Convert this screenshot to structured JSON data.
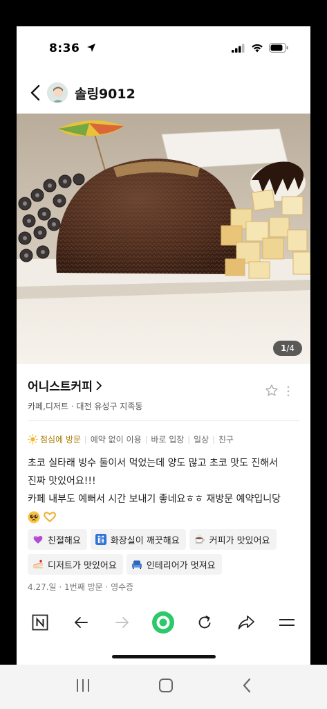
{
  "status_bar": {
    "time": "8:36"
  },
  "header": {
    "username": "솔링9012"
  },
  "photo": {
    "counter_current": "1",
    "counter_total": "4",
    "counter_separator": "/"
  },
  "place": {
    "name": "어니스트커피",
    "category": "카페,디저트",
    "location": "대전 유성구 지족동",
    "meta_separator": " · "
  },
  "tags": {
    "visit_time": "점심에 방문",
    "items": [
      "예약 없이 이용",
      "바로 입장",
      "일상",
      "친구"
    ]
  },
  "review": {
    "line1": "초코 실타래 빙수 둘이서 먹었는데 양도 많고 초코 맛도 진해서",
    "line2": "진짜 맛있어요!!!",
    "line3": "카페 내부도 예뻐서 시간 보내기 좋네요ㅎㅎ 재방문 예약입니당",
    "emojis": [
      "pleading-face-icon",
      "heart-hands-icon"
    ]
  },
  "keywords": [
    {
      "label": "친절해요",
      "icon": "purple-heart-icon"
    },
    {
      "label": "화장실이 깨끗해요",
      "icon": "restroom-icon"
    },
    {
      "label": "커피가 맛있어요",
      "icon": "coffee-icon"
    },
    {
      "label": "디저트가 맛있어요",
      "icon": "cake-icon"
    },
    {
      "label": "인테리어가 멋져요",
      "icon": "armchair-icon"
    }
  ],
  "visit_info": "4.27.일 · 1번째 방문 · 영수증",
  "colors": {
    "accent_green": "#2bc96a",
    "visit_gold": "#a57c00",
    "chip_bg": "#f3f3f3"
  }
}
